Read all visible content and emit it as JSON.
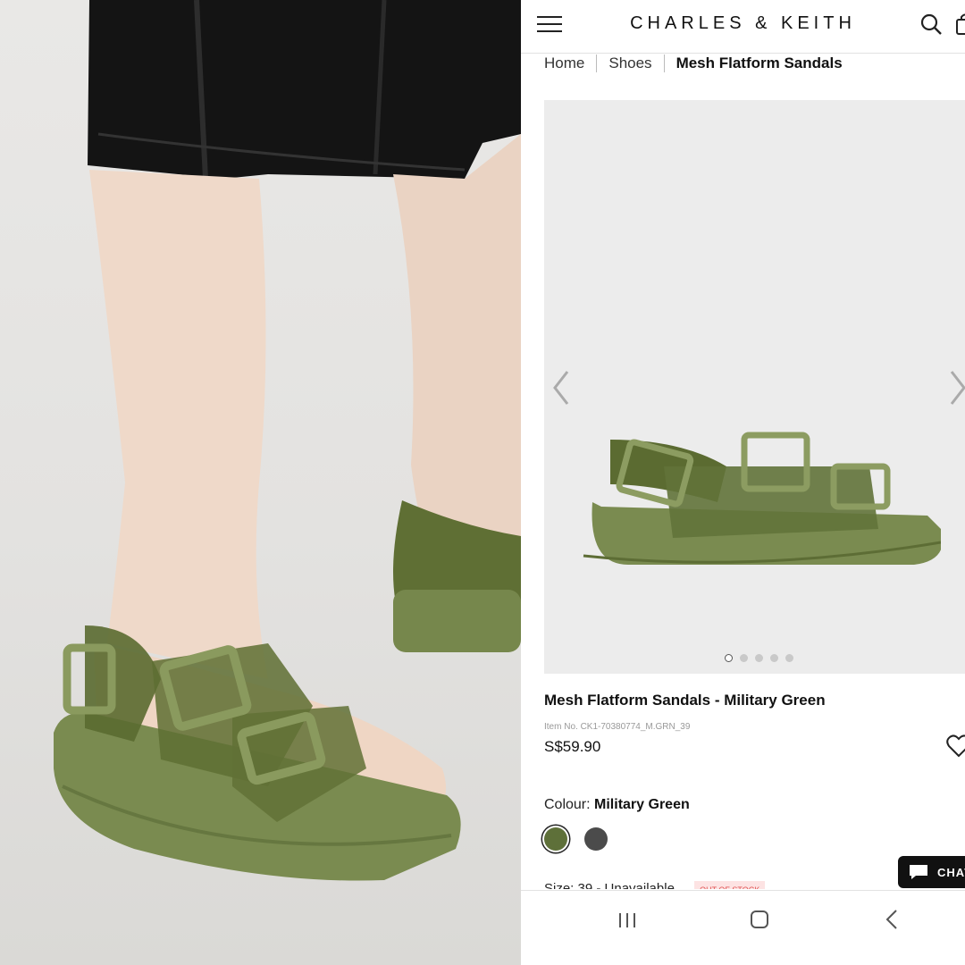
{
  "header": {
    "brand": "CHARLES & KEITH"
  },
  "breadcrumb": {
    "items": [
      "Home",
      "Shoes"
    ],
    "current": "Mesh Flatform Sandals"
  },
  "gallery": {
    "slide_count": 5,
    "active_slide": 1
  },
  "product": {
    "title": "Mesh Flatform Sandals - Military Green",
    "item_no": "Item No. CK1-70380774_M.GRN_39",
    "price": "S$59.90"
  },
  "colour": {
    "label": "Colour:",
    "selected": "Military Green",
    "swatches": [
      {
        "name": "Military Green",
        "color": "#5e7039"
      },
      {
        "name": "Dark Grey",
        "color": "#4b4b4b"
      }
    ]
  },
  "size": {
    "label": "Size: 39 - Unavailable",
    "badge": "OUT OF STOCK"
  },
  "chat": {
    "label": "CHAT"
  },
  "colors": {
    "sandal_green": "#6e7d45",
    "background": "#ececec"
  }
}
